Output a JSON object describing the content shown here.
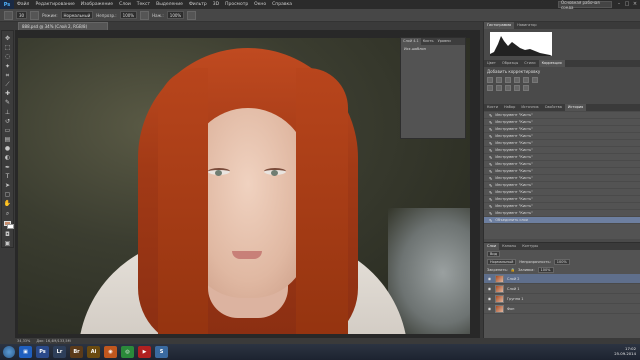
{
  "menubar": {
    "logo": "Ps",
    "items": [
      "Файл",
      "Редактирование",
      "Изображение",
      "Слои",
      "Текст",
      "Выделение",
      "Фильтр",
      "3D",
      "Просмотр",
      "Окно",
      "Справка"
    ],
    "workspace": "Основная рабочая среда"
  },
  "options": {
    "mode_label": "Режим:",
    "mode_value": "Нормальный",
    "opacity_label": "Непрозр.:",
    "opacity_value": "100%",
    "flow_label": "Наж.:",
    "flow_value": "100%",
    "size_value": "30"
  },
  "document": {
    "tab_title": "888.psd @ 34% (Слой 2, RGB/8)",
    "zoom": "34,33%",
    "doc_info": "Док: 16,4M/133,5M"
  },
  "history_float": {
    "tabs": [
      "Слой 4.1",
      "Кисть",
      "Уровни"
    ],
    "item": "Исх.шаблон"
  },
  "right_panel": {
    "top_tabs": [
      "Гистограмма",
      "Навигатор"
    ],
    "adj_tabs": [
      "Цвет",
      "Образцы",
      "Стили",
      "Коррекция"
    ],
    "adj_title": "Добавить корректировку",
    "history_tabs": [
      "Кисти",
      "Набор",
      "Источник",
      "Свойства",
      "История"
    ],
    "history_items": [
      "Инструмент \"Кисть\"",
      "Инструмент \"Кисть\"",
      "Инструмент \"Кисть\"",
      "Инструмент \"Кисть\"",
      "Инструмент \"Кисть\"",
      "Инструмент \"Кисть\"",
      "Инструмент \"Кисть\"",
      "Инструмент \"Кисть\"",
      "Инструмент \"Кисть\"",
      "Инструмент \"Кисть\"",
      "Инструмент \"Кисть\"",
      "Инструмент \"Кисть\"",
      "Инструмент \"Кисть\"",
      "Инструмент \"Кисть\"",
      "Инструмент \"Кисть\"",
      "Объединить слои"
    ]
  },
  "layers": {
    "tabs": [
      "Слои",
      "Каналы",
      "Контуры"
    ],
    "kind": "Вид",
    "blend": "Нормальный",
    "opacity_label": "Непрозрачность:",
    "opacity_value": "100%",
    "lock_label": "Закрепить:",
    "fill_label": "Заливка:",
    "fill_value": "100%",
    "rows": [
      "Слой 2",
      "Слой 1",
      "Группа 1",
      "Фон"
    ]
  },
  "taskbar": {
    "apps": [
      "Ps",
      "Lr",
      "Br",
      "Ai"
    ],
    "lang": "RU",
    "time": "17:02",
    "date": "25.09.2014"
  },
  "colors": {
    "foreground": "#c68c6c",
    "background": "#ffffff",
    "accent": "#6d7fa0"
  }
}
